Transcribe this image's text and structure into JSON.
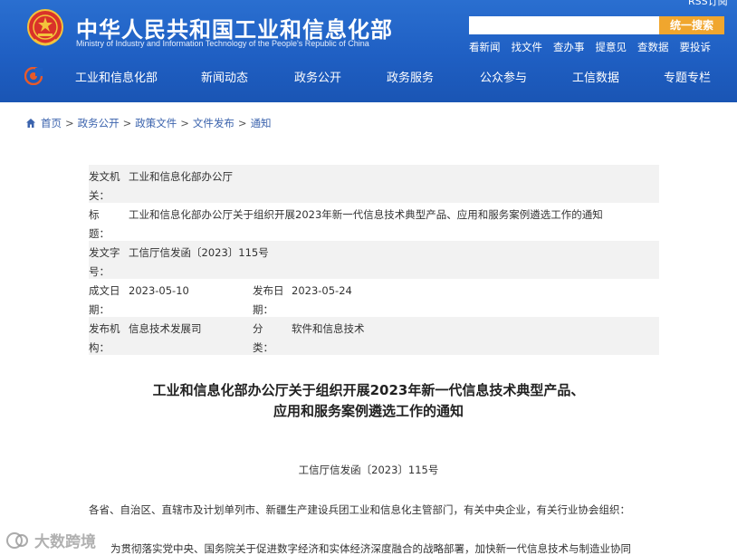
{
  "header": {
    "site_title": "中华人民共和国工业和信息化部",
    "site_subtitle": "Ministry of Industry and Information Technology of the People's Republic of China",
    "top_link": "RSS订阅",
    "search_placeholder": "",
    "search_button": "统一搜索",
    "quick_links": [
      "看新闻",
      "找文件",
      "查办事",
      "提意见",
      "查数据",
      "要投诉"
    ]
  },
  "nav": {
    "items": [
      "工业和信息化部",
      "新闻动态",
      "政务公开",
      "政务服务",
      "公众参与",
      "工信数据",
      "专题专栏"
    ]
  },
  "breadcrumb": [
    "首页",
    "政务公开",
    "政策文件",
    "文件发布",
    "通知"
  ],
  "meta": {
    "issuer_label": "发文机关：",
    "issuer": "工业和信息化部办公厅",
    "title_label": "标　　题：",
    "title": "工业和信息化部办公厅关于组织开展2023年新一代信息技术典型产品、应用和服务案例遴选工作的通知",
    "doc_no_label": "发文字号：",
    "doc_no": "工信厅信发函〔2023〕115号",
    "created_label": "成文日期：",
    "created": "2023-05-10",
    "published_label": "发布日期：",
    "published": "2023-05-24",
    "org_label": "发布机构：",
    "org": "信息技术发展司",
    "category_label": "分　　类：",
    "category": "软件和信息技术"
  },
  "document": {
    "title_line1": "工业和信息化部办公厅关于组织开展2023年新一代信息技术典型产品、",
    "title_line2": "应用和服务案例遴选工作的通知",
    "number": "工信厅信发函〔2023〕115号",
    "salutation": "各省、自治区、直辖市及计划单列市、新疆生产建设兵团工业和信息化主管部门，有关中央企业，有关行业协会组织：",
    "para1": "为贯彻落实党中央、国务院关于促进数字经济和实体经济深度融合的战略部署，加快新一代信息技术与制造业协同"
  },
  "watermark": "大数跨境",
  "colors": {
    "header_blue": "#1f5fc3",
    "search_orange": "#f0a62e",
    "link_blue": "#3b63ad",
    "row_gray": "#f2f2f2"
  }
}
